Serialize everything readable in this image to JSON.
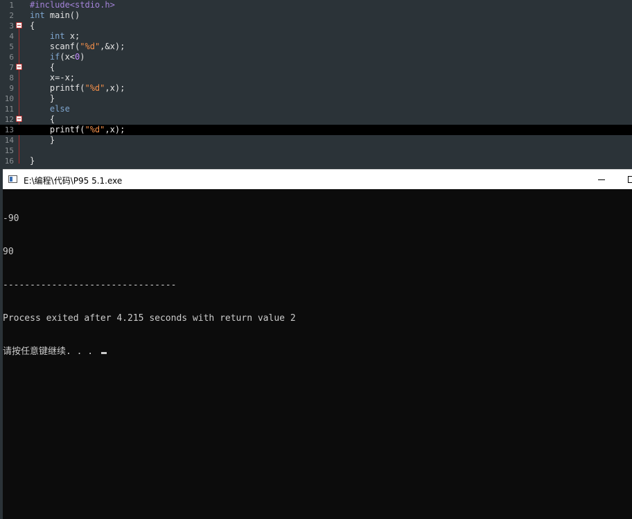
{
  "editor": {
    "lines": [
      {
        "n": "1",
        "tokens": [
          {
            "t": "#include<stdio.h>",
            "c": "pp"
          }
        ]
      },
      {
        "n": "2",
        "tokens": [
          {
            "t": "int",
            "c": "kw"
          },
          {
            "t": " main()",
            "c": "id"
          }
        ]
      },
      {
        "n": "3",
        "tokens": [
          {
            "t": "{",
            "c": "id"
          }
        ],
        "fold": true
      },
      {
        "n": "4",
        "tokens": [
          {
            "t": "    "
          },
          {
            "t": "int",
            "c": "kw"
          },
          {
            "t": " x;",
            "c": "id"
          }
        ]
      },
      {
        "n": "5",
        "tokens": [
          {
            "t": "    "
          },
          {
            "t": "scanf(",
            "c": "id"
          },
          {
            "t": "\"%d\"",
            "c": "str"
          },
          {
            "t": ",&x);",
            "c": "id"
          }
        ]
      },
      {
        "n": "6",
        "tokens": [
          {
            "t": "    "
          },
          {
            "t": "if",
            "c": "kw"
          },
          {
            "t": "(x<",
            "c": "id"
          },
          {
            "t": "0",
            "c": "num"
          },
          {
            "t": ")",
            "c": "id"
          }
        ]
      },
      {
        "n": "7",
        "tokens": [
          {
            "t": "    "
          },
          {
            "t": "{",
            "c": "id"
          }
        ],
        "fold": true
      },
      {
        "n": "8",
        "tokens": [
          {
            "t": "    "
          },
          {
            "t": "x=-x;",
            "c": "id"
          }
        ]
      },
      {
        "n": "9",
        "tokens": [
          {
            "t": "    "
          },
          {
            "t": "printf(",
            "c": "id"
          },
          {
            "t": "\"%d\"",
            "c": "str"
          },
          {
            "t": ",x);",
            "c": "id"
          }
        ]
      },
      {
        "n": "10",
        "tokens": [
          {
            "t": "    "
          },
          {
            "t": "}",
            "c": "id"
          }
        ]
      },
      {
        "n": "11",
        "tokens": [
          {
            "t": "    "
          },
          {
            "t": "else",
            "c": "kw"
          }
        ]
      },
      {
        "n": "12",
        "tokens": [
          {
            "t": "    "
          },
          {
            "t": "{",
            "c": "id"
          }
        ],
        "fold": true
      },
      {
        "n": "13",
        "tokens": [
          {
            "t": "    "
          },
          {
            "t": "printf(",
            "c": "id"
          },
          {
            "t": "\"%d\"",
            "c": "str"
          },
          {
            "t": ",x);",
            "c": "id"
          }
        ],
        "current": true
      },
      {
        "n": "14",
        "tokens": [
          {
            "t": "    "
          },
          {
            "t": "}",
            "c": "id"
          }
        ]
      },
      {
        "n": "15",
        "tokens": []
      },
      {
        "n": "16",
        "tokens": [
          {
            "t": "}",
            "c": "id"
          }
        ]
      }
    ]
  },
  "console": {
    "title": "E:\\编程\\代码\\P95 5.1.exe",
    "output": [
      "-90",
      "90",
      "--------------------------------",
      "Process exited after 4.215 seconds with return value 2",
      "请按任意键继续. . . "
    ]
  },
  "colors": {
    "editor_bg": "#2b3338",
    "console_bg": "#0c0c0c",
    "fold_marker": "#b02a2a"
  }
}
